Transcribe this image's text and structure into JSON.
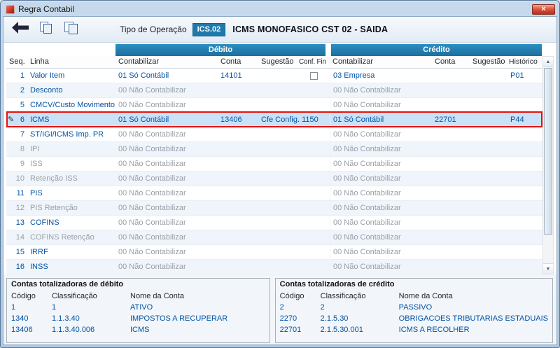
{
  "window": {
    "title": "Regra Contabil",
    "close_glyph": "×"
  },
  "icons": {
    "scroll_up": "▲",
    "scroll_down": "▼",
    "edit_marker": "✎",
    "close": "×"
  },
  "colors": {
    "accent_teal": "#1e7aad",
    "link_blue": "#0054a6",
    "disabled_gray": "#99a0a7",
    "selected_row_bg": "#c9e2f8",
    "annotation_red": "#e5130b"
  },
  "toolbar": {
    "operation_label": "Tipo de Operação",
    "operation_code": "ICS.02",
    "operation_title": "ICMS MONOFASICO CST 02 - SAIDA"
  },
  "grid": {
    "group_debit": "Débito",
    "group_credit": "Crédito",
    "headers": {
      "seq": "Seq.",
      "linha": "Linha",
      "contabilizar_debit": "Contabilizar",
      "conta_debit": "Conta",
      "sugestao_debit": "Sugestão",
      "conf_fin": "Conf. Fin",
      "contabilizar_credit": "Contabilizar",
      "conta_credit": "Conta",
      "sugestao_credit": "Sugestão",
      "historico": "Histórico"
    },
    "rows": [
      {
        "seq": "1",
        "linha": "Valor Item",
        "d_cont": "01 Só Contábil",
        "d_conta": "14101",
        "d_sug": "",
        "conf": "unchecked",
        "c_cont": "03 Empresa",
        "c_conta": "",
        "c_sug": "",
        "hist": "P01",
        "dim": false,
        "selected": false
      },
      {
        "seq": "2",
        "linha": "Desconto",
        "d_cont": "00 Não Contabilizar",
        "d_conta": "",
        "d_sug": "",
        "conf": "",
        "c_cont": "00 Não Contabilizar",
        "c_conta": "",
        "c_sug": "",
        "hist": "",
        "dim": false,
        "selected": false
      },
      {
        "seq": "5",
        "linha": "CMCV/Custo Movimento",
        "d_cont": "00 Não Contabilizar",
        "d_conta": "",
        "d_sug": "",
        "conf": "",
        "c_cont": "00 Não Contabilizar",
        "c_conta": "",
        "c_sug": "",
        "hist": "",
        "dim": false,
        "selected": false
      },
      {
        "seq": "6",
        "linha": "ICMS",
        "d_cont": "01 Só Contábil",
        "d_conta": "13406",
        "d_sug": "Cfe Config. 1150",
        "conf": "",
        "c_cont": "01 Só Contábil",
        "c_conta": "22701",
        "c_sug": "",
        "hist": "P44",
        "dim": false,
        "selected": true
      },
      {
        "seq": "7",
        "linha": "ST/IGI/ICMS Imp. PR",
        "d_cont": "00 Não Contabilizar",
        "d_conta": "",
        "d_sug": "",
        "conf": "",
        "c_cont": "00 Não Contabilizar",
        "c_conta": "",
        "c_sug": "",
        "hist": "",
        "dim": false,
        "selected": false
      },
      {
        "seq": "8",
        "linha": "IPI",
        "d_cont": "00 Não Contabilizar",
        "d_conta": "",
        "d_sug": "",
        "conf": "",
        "c_cont": "00 Não Contabilizar",
        "c_conta": "",
        "c_sug": "",
        "hist": "",
        "dim": true,
        "selected": false
      },
      {
        "seq": "9",
        "linha": "ISS",
        "d_cont": "00 Não Contabilizar",
        "d_conta": "",
        "d_sug": "",
        "conf": "",
        "c_cont": "00 Não Contabilizar",
        "c_conta": "",
        "c_sug": "",
        "hist": "",
        "dim": true,
        "selected": false
      },
      {
        "seq": "10",
        "linha": "Retenção ISS",
        "d_cont": "00 Não Contabilizar",
        "d_conta": "",
        "d_sug": "",
        "conf": "",
        "c_cont": "00 Não Contabilizar",
        "c_conta": "",
        "c_sug": "",
        "hist": "",
        "dim": true,
        "selected": false
      },
      {
        "seq": "11",
        "linha": "PIS",
        "d_cont": "00 Não Contabilizar",
        "d_conta": "",
        "d_sug": "",
        "conf": "",
        "c_cont": "00 Não Contabilizar",
        "c_conta": "",
        "c_sug": "",
        "hist": "",
        "dim": false,
        "selected": false
      },
      {
        "seq": "12",
        "linha": "PIS Retenção",
        "d_cont": "00 Não Contabilizar",
        "d_conta": "",
        "d_sug": "",
        "conf": "",
        "c_cont": "00 Não Contabilizar",
        "c_conta": "",
        "c_sug": "",
        "hist": "",
        "dim": true,
        "selected": false
      },
      {
        "seq": "13",
        "linha": "COFINS",
        "d_cont": "00 Não Contabilizar",
        "d_conta": "",
        "d_sug": "",
        "conf": "",
        "c_cont": "00 Não Contabilizar",
        "c_conta": "",
        "c_sug": "",
        "hist": "",
        "dim": false,
        "selected": false
      },
      {
        "seq": "14",
        "linha": "COFINS Retenção",
        "d_cont": "00 Não Contabilizar",
        "d_conta": "",
        "d_sug": "",
        "conf": "",
        "c_cont": "00 Não Contabilizar",
        "c_conta": "",
        "c_sug": "",
        "hist": "",
        "dim": true,
        "selected": false
      },
      {
        "seq": "15",
        "linha": "IRRF",
        "d_cont": "00 Não Contabilizar",
        "d_conta": "",
        "d_sug": "",
        "conf": "",
        "c_cont": "00 Não Contabilizar",
        "c_conta": "",
        "c_sug": "",
        "hist": "",
        "dim": false,
        "selected": false
      },
      {
        "seq": "16",
        "linha": "INSS",
        "d_cont": "00 Não Contabilizar",
        "d_conta": "",
        "d_sug": "",
        "conf": "",
        "c_cont": "00 Não Contabilizar",
        "c_conta": "",
        "c_sug": "",
        "hist": "",
        "dim": false,
        "selected": false
      }
    ]
  },
  "debit_totals": {
    "title": "Contas totalizadoras de débito",
    "headers": {
      "codigo": "Código",
      "classificacao": "Classificação",
      "nome": "Nome da Conta"
    },
    "rows": [
      {
        "codigo": "1",
        "classificacao": "1",
        "nome": "ATIVO"
      },
      {
        "codigo": "1340",
        "classificacao": "1.1.3.40",
        "nome": "IMPOSTOS A RECUPERAR"
      },
      {
        "codigo": "13406",
        "classificacao": "1.1.3.40.006",
        "nome": "ICMS"
      }
    ]
  },
  "credit_totals": {
    "title": "Contas totalizadoras de crédito",
    "headers": {
      "codigo": "Código",
      "classificacao": "Classificação",
      "nome": "Nome da Conta"
    },
    "rows": [
      {
        "codigo": "2",
        "classificacao": "2",
        "nome": "PASSIVO"
      },
      {
        "codigo": "2270",
        "classificacao": "2.1.5.30",
        "nome": "OBRIGACOES TRIBUTARIAS ESTADUAIS"
      },
      {
        "codigo": "22701",
        "classificacao": "2.1.5.30.001",
        "nome": "ICMS A RECOLHER"
      }
    ]
  }
}
